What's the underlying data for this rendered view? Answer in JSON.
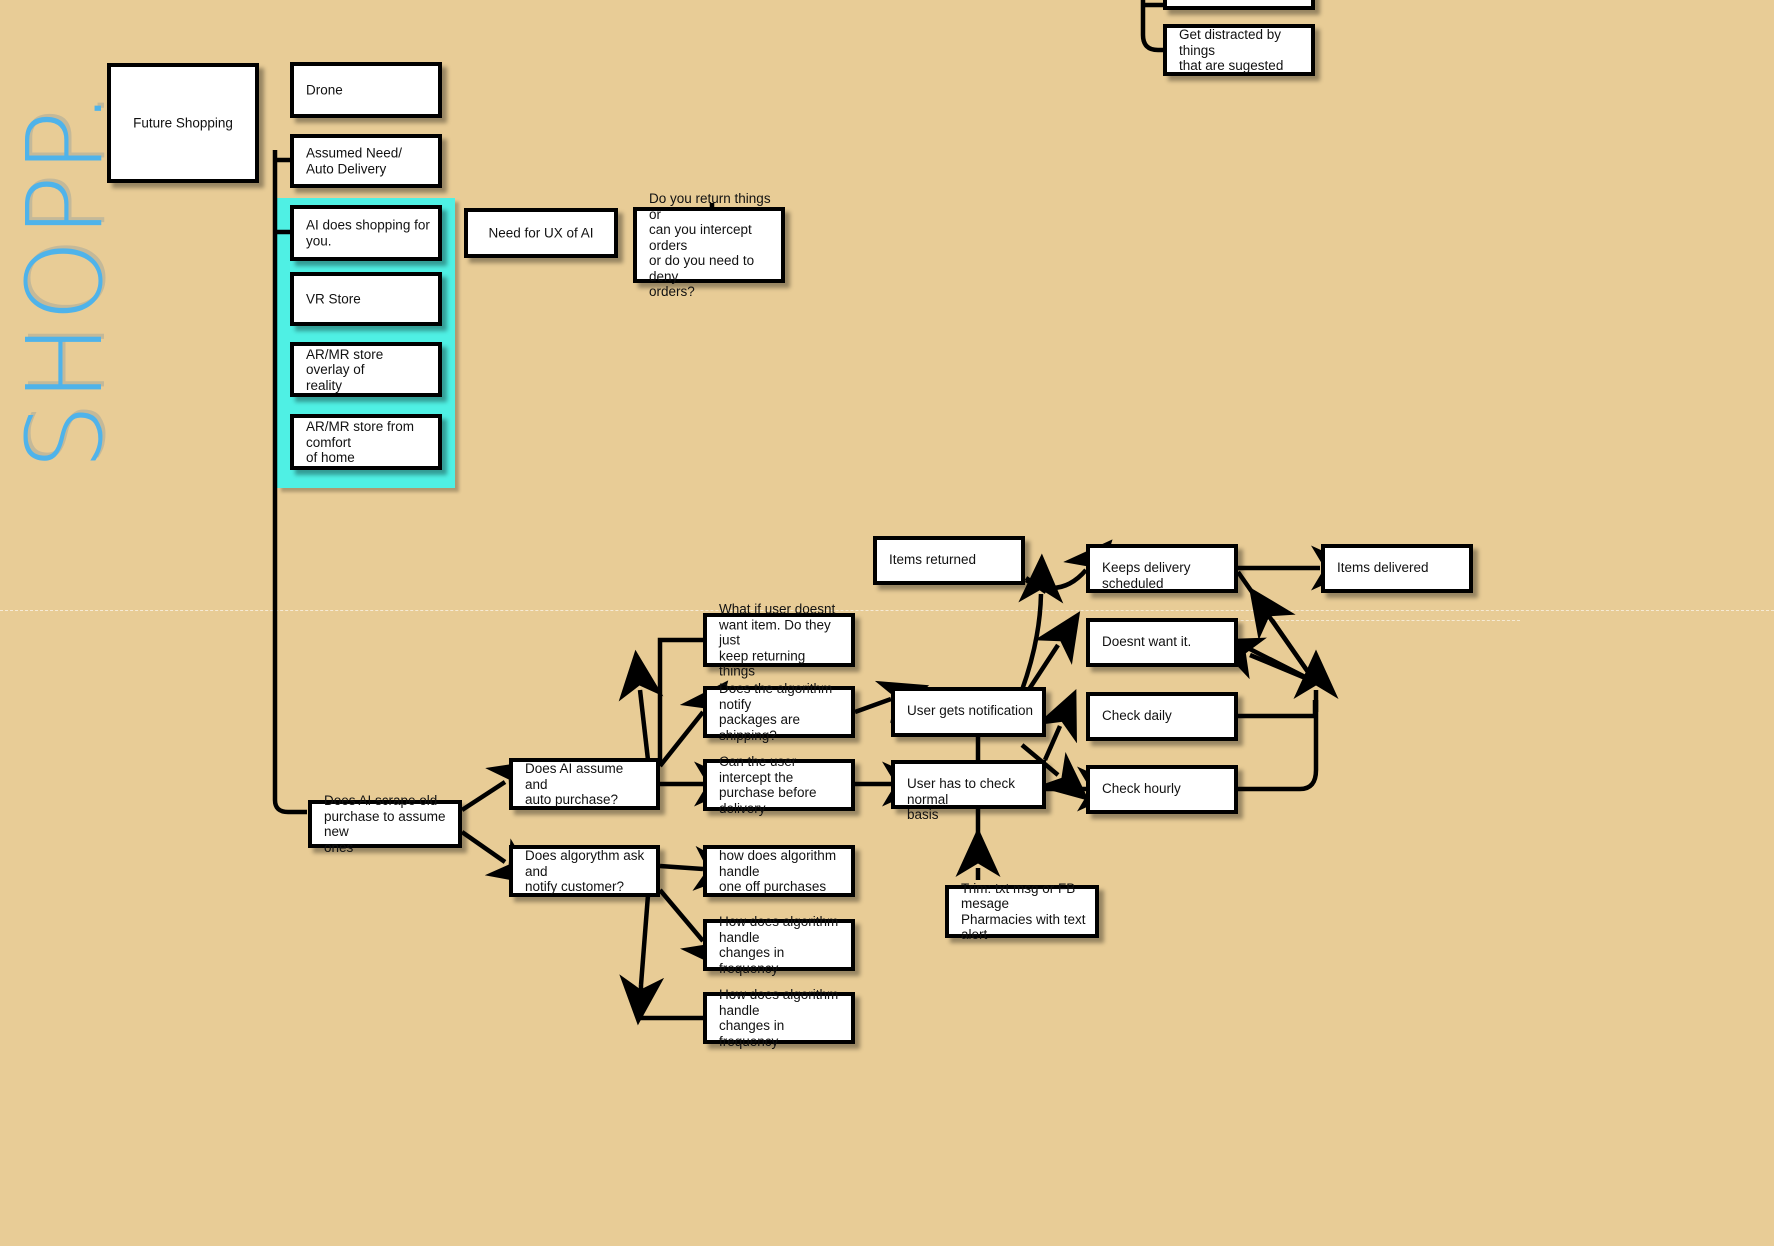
{
  "canvas": {
    "background_color": "#e8cc96",
    "highlight_color": "#4ff0e4",
    "wordmark_color": "#4fb3ea",
    "node_fill": "#ffffff",
    "node_border": "#000000"
  },
  "wordmark": {
    "text": "SHOPP."
  },
  "nodes": {
    "future_shopping": "Future Shopping",
    "drone": "Drone",
    "assumed_need": "Assumed Need/\nAuto Delivery",
    "ai_does_shopping": "AI does shopping for\nyou.",
    "vr_store": "VR Store",
    "ar_overlay": "AR/MR store overlay of\nreality",
    "ar_home": "AR/MR store from comfort\nof home",
    "need_ux_ai": "Need for UX of AI",
    "do_you_return": "Do you return things or\ncan you intercept orders\nor do you need to deny\norders?",
    "get_distracted": "Get distracted by things\nthat are sugested",
    "clipped_top": "",
    "does_ai_scrape": "Does AI scrape old\npurchase to assume new\nones",
    "does_ai_assume": "Does AI assume and\nauto purchase?",
    "does_algorythm_ask": "Does algorythm ask and\nnotify customer?",
    "what_if_user": "What if user doesnt\nwant item. Do they just\nkeep returning things",
    "does_algorithm_notify": "Does the algorithm notify\npackages are shipping?",
    "can_user_intercept": "Can the user intercept the\npurchase before delivery",
    "how_one_off": "how does algorithm handle\none off purchases",
    "how_changes_freq_1": "How does algorithm handle\nchanges in frequency",
    "how_changes_freq_2": "How does algorithm handle\nchanges in frequency",
    "items_returned": "Items returned",
    "user_gets_notification": "User gets notification",
    "user_has_to_check": "User has to check normal\nbasis",
    "keeps_delivery": "Keeps delivery scheduled",
    "doesnt_want_it": "Doesnt want it.",
    "check_daily": "Check daily",
    "check_hourly": "Check hourly",
    "items_delivered": "Items delivered",
    "trim": "Trim: txt msg or FB mesage\nPharmacies with text alert"
  }
}
